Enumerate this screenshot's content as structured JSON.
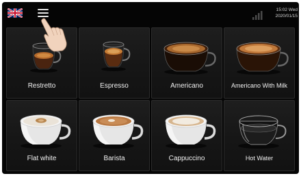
{
  "header": {
    "language_flag": "uk-flag-icon",
    "menu_icon": "hamburger-menu-icon",
    "signal_icon": "signal-bars-icon",
    "time": "15:02 Wed",
    "date": "2020/01/15"
  },
  "drinks": [
    {
      "label": "Restretto",
      "icon": "restretto-cup-icon"
    },
    {
      "label": "Espresso",
      "icon": "espresso-cup-icon"
    },
    {
      "label": "Americano",
      "icon": "americano-cup-icon"
    },
    {
      "label": "Americano With Milk",
      "icon": "americano-with-milk-cup-icon"
    },
    {
      "label": "Flat white",
      "icon": "flat-white-cup-icon"
    },
    {
      "label": "Barista",
      "icon": "barista-cup-icon"
    },
    {
      "label": "Cappuccino",
      "icon": "cappuccino-cup-icon"
    },
    {
      "label": "Hot Water",
      "icon": "hot-water-cup-icon"
    }
  ]
}
